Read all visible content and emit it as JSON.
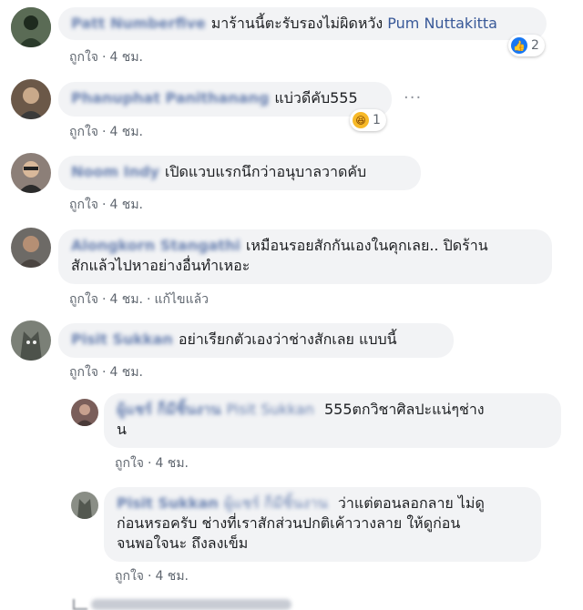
{
  "comments": [
    {
      "name": "Patt Numberfive",
      "text": "มาร้านนี้ตะรับรองไม่ผิดหวัง",
      "mention": "Pum Nuttakitta",
      "like": "ถูกใจ",
      "time": "4 ชม.",
      "reaction_icon": "like-icon",
      "reaction_count": "2"
    },
    {
      "name": "Phanuphat Panithanang",
      "text": "แบ่วดีคับ555",
      "like": "ถูกใจ",
      "time": "4 ชม.",
      "reaction_icon": "haha-icon",
      "reaction_count": "1"
    },
    {
      "name": "Noom Indy",
      "text": "เปิดแวบแรกนึกว่าอนุบาลวาดคับ",
      "like": "ถูกใจ",
      "time": "4 ชม."
    },
    {
      "name": "Alongkorn Stangathi",
      "text_line1": "เหมือนรอยสักกันเองในคุกเลย.. ปิดร้าน",
      "text_line2": "สักแล้วไปหาอย่างอื่นทำเหอะ",
      "like": "ถูกใจ",
      "time": "4 ชม.",
      "edited": "แก้ไขแล้ว"
    },
    {
      "name": "Pisit Sukkan",
      "text": "อย่าเรียกตัวเองว่าช่างสักเลย แบบนี้",
      "like": "ถูกใจ",
      "time": "4 ชม."
    }
  ],
  "replies": [
    {
      "name": "ผู้แชร์ ก็มีชิ้นงาน",
      "mention": "Pisit Sukkan",
      "text_line1": "555ตกวิชาศิลปะแน่ๆช่าง",
      "text_line2": "น",
      "like": "ถูกใจ",
      "time": "4 ชม."
    },
    {
      "name": "Pisit Sukkan",
      "mention": "ผู้แชร์ ก็มีชิ้นงาน",
      "text_line1": "ว่าแต่ตอนลอกลาย ไม่ดู",
      "text_line2": "ก่อนหรอครับ ช่างที่เราสักส่วนปกติเค้าวางลาย ให้ดูก่อน",
      "text_line3": "จนพอใจนะ ถึงลงเข็ม",
      "like": "ถูกใจ",
      "time": "4 ชม."
    }
  ],
  "more_icon": "more-options-icon"
}
